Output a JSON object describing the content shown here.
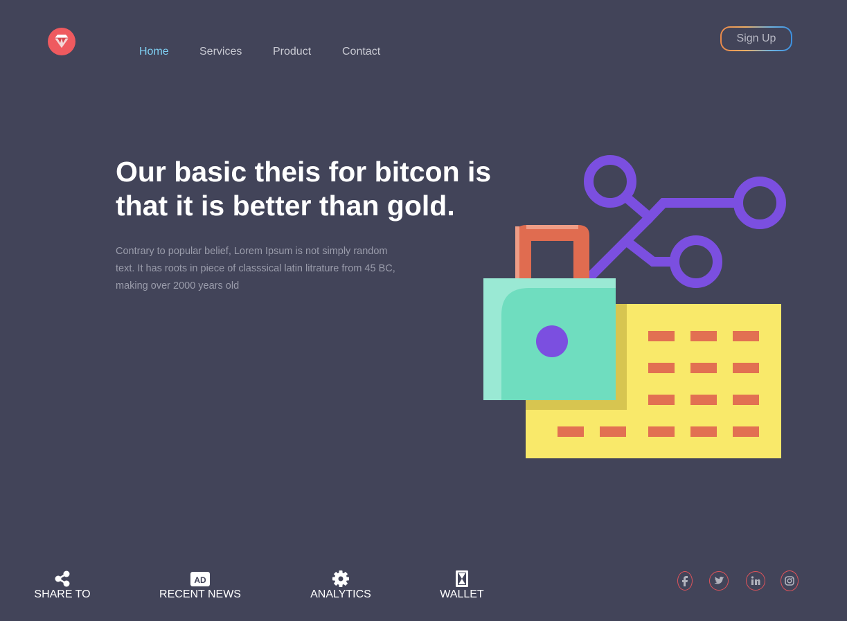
{
  "brand": {
    "logo_icon": "diamond-icon",
    "logo_color": "#ef5a5f"
  },
  "nav": {
    "items": [
      {
        "label": "Home",
        "active": true
      },
      {
        "label": "Services",
        "active": false
      },
      {
        "label": "Product",
        "active": false
      },
      {
        "label": "Contact",
        "active": false
      }
    ],
    "active_color": "#7fd0f3"
  },
  "header": {
    "signup_label": "Sign Up"
  },
  "hero": {
    "headline_line1": "Our basic theis for bitcon is",
    "headline_line2": "that it is better than gold.",
    "paragraph_line1": "Contrary to popular belief, Lorem Ipsum is not simply random",
    "paragraph_line2": "text. It has roots in piece of classsical latin litrature from 45 BC,",
    "paragraph_line3": "making over 2000 years old"
  },
  "illustration": {
    "icons": [
      "padlock-icon",
      "network-icon",
      "keypad-icon"
    ],
    "colors": {
      "network": "#7b4fe0",
      "padlock_shackle": "#e06c50",
      "padlock_body": "#6fddbf",
      "keypad": "#f9e96a",
      "keys": "#e27052"
    }
  },
  "bottom_bar": {
    "items": [
      {
        "label": "SHARE TO",
        "icon": "share-icon"
      },
      {
        "label": "RECENT NEWS",
        "icon": "ad-icon"
      },
      {
        "label": "ANALYTICS",
        "icon": "gear-icon"
      },
      {
        "label": "WALLET",
        "icon": "hourglass-icon"
      }
    ],
    "social": [
      "facebook-icon",
      "twitter-icon",
      "linkedin-icon",
      "instagram-icon"
    ],
    "social_color": "#e0535a"
  },
  "colors": {
    "background": "#424459",
    "text": "#ffffff",
    "muted_text": "#9a9cab"
  }
}
